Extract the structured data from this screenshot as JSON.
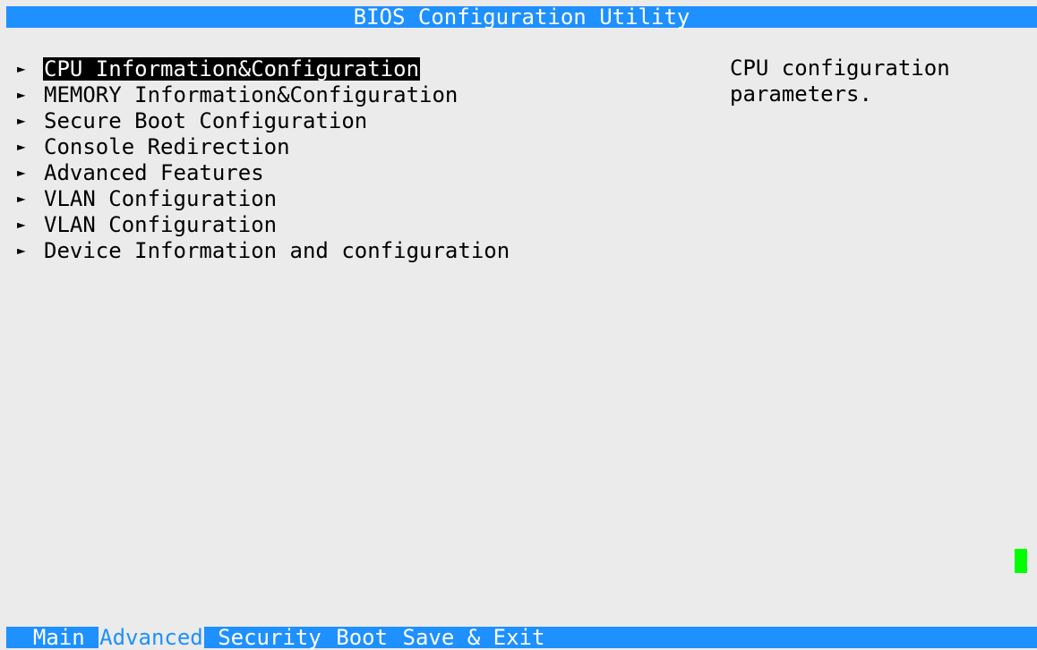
{
  "title": "BIOS Configuration Utility",
  "menu": {
    "items": [
      {
        "arrow": "►",
        "label": "CPU Information&Configuration",
        "selected": true
      },
      {
        "arrow": "►",
        "label": "MEMORY Information&Configuration",
        "selected": false
      },
      {
        "arrow": "►",
        "label": "Secure Boot Configuration",
        "selected": false
      },
      {
        "arrow": "►",
        "label": "Console Redirection",
        "selected": false
      },
      {
        "arrow": "►",
        "label": "Advanced Features",
        "selected": false
      },
      {
        "arrow": "►",
        "label": "VLAN Configuration",
        "selected": false
      },
      {
        "arrow": "►",
        "label": "VLAN Configuration",
        "selected": false
      },
      {
        "arrow": "►",
        "label": "Device Information and configuration",
        "selected": false
      }
    ]
  },
  "help": {
    "line1": "CPU configuration",
    "line2": "parameters."
  },
  "tabs": {
    "items": [
      {
        "label": "Main",
        "active": false
      },
      {
        "label": "Advanced",
        "active": true
      },
      {
        "label": "Security",
        "active": false
      },
      {
        "label": "Boot",
        "active": false
      },
      {
        "label": "Save & Exit",
        "active": false
      }
    ]
  },
  "colors": {
    "accent": "#1e90ff",
    "background": "#ebebeb",
    "cursor": "#00ff00",
    "selection_bg": "#000000"
  }
}
